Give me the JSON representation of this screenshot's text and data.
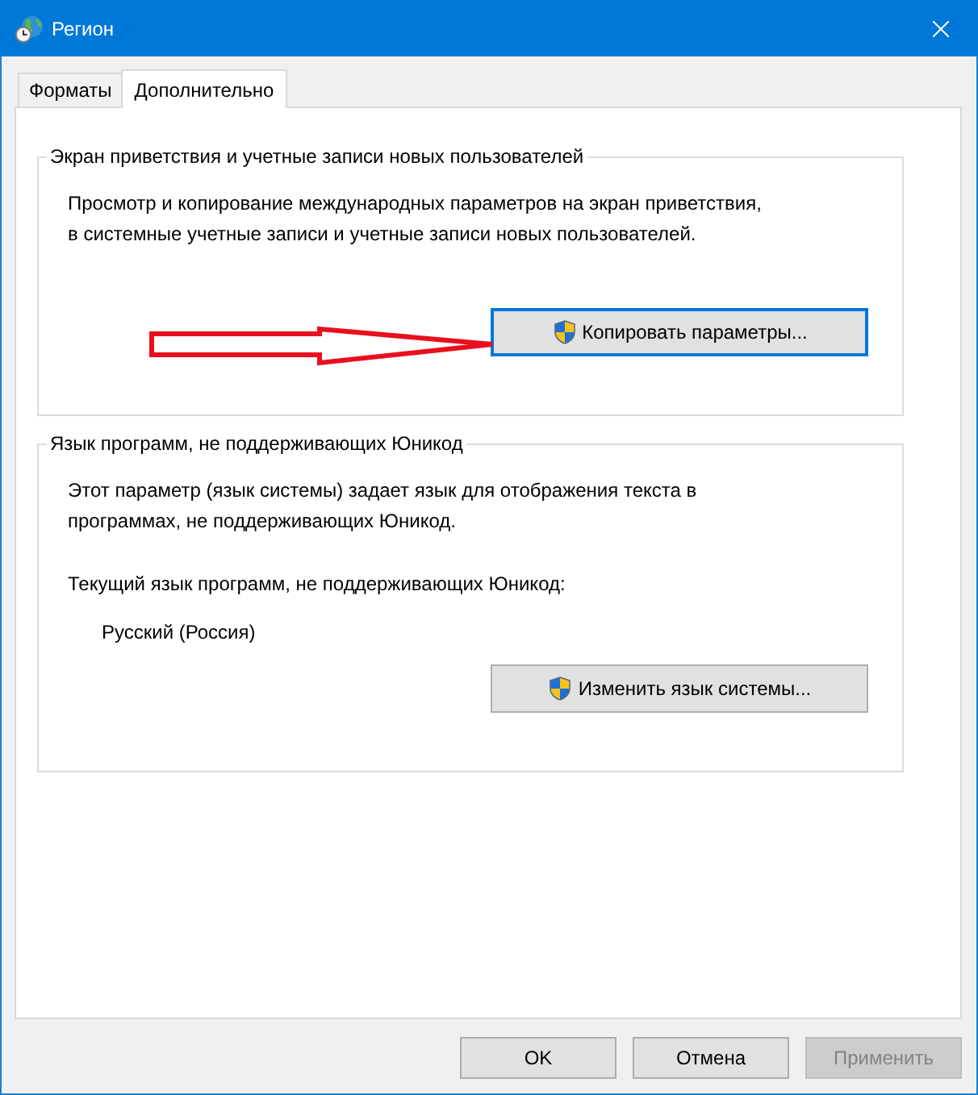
{
  "window": {
    "title": "Регион"
  },
  "tabs": [
    {
      "label": "Форматы",
      "selected": false
    },
    {
      "label": "Дополнительно",
      "selected": true
    }
  ],
  "groups": [
    {
      "title": "Экран приветствия и учетные записи новых пользователей",
      "paragraphs": [
        "Просмотр и копирование международных параметров на экран приветствия,\nв системные учетные записи и учетные записи новых пользователей."
      ],
      "button": {
        "label": "Копировать параметры...",
        "focused": true
      }
    },
    {
      "title": "Язык программ, не поддерживающих Юникод",
      "paragraphs": [
        "Этот параметр (язык системы) задает язык для отображения текста в\nпрограммах, не поддерживающих Юникод.",
        "Текущий язык программ, не поддерживающих Юникод:"
      ],
      "value": "Русский (Россия)",
      "button": {
        "label": "Изменить язык системы...",
        "focused": false
      }
    }
  ],
  "buttons": [
    {
      "label": "OK",
      "disabled": false
    },
    {
      "label": "Отмена",
      "disabled": false
    },
    {
      "label": "Применить",
      "disabled": true
    }
  ]
}
